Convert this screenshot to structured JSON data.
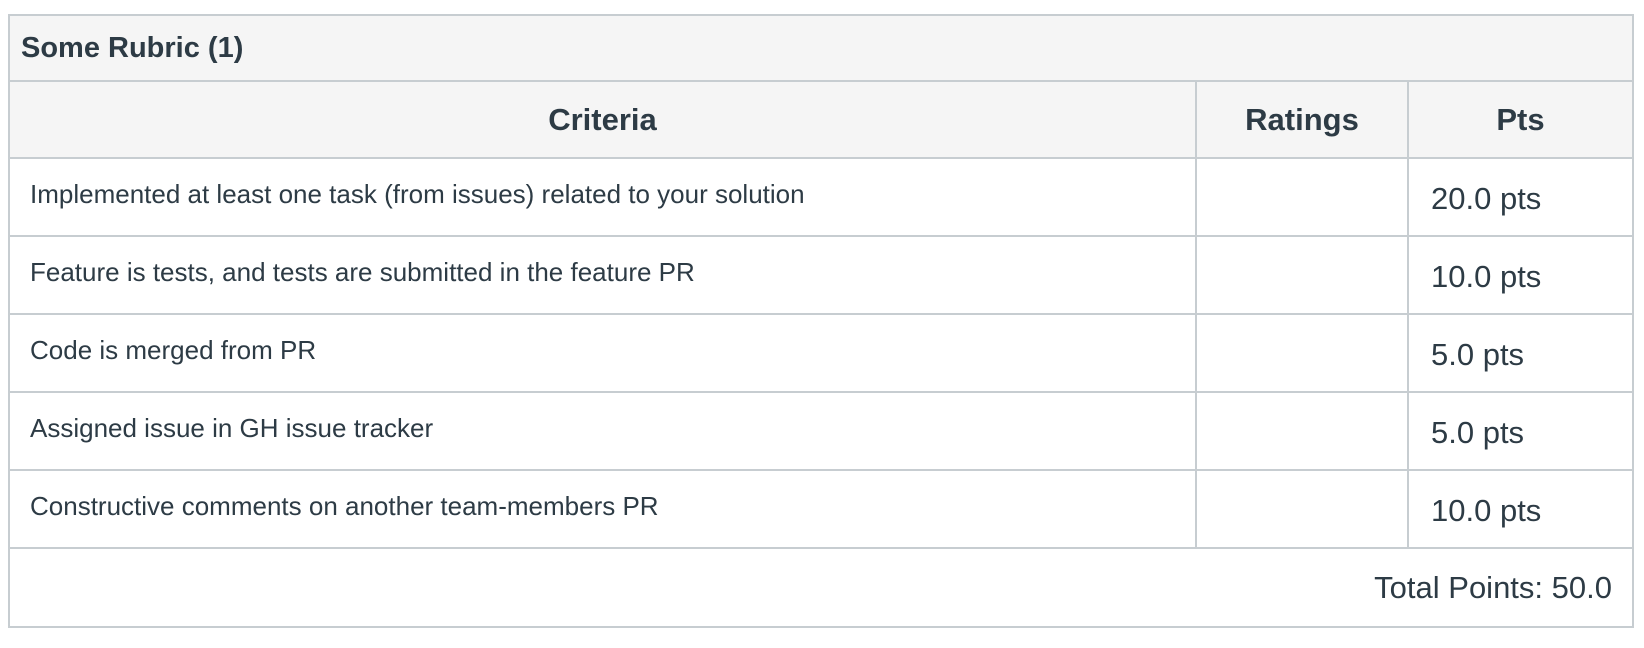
{
  "rubric": {
    "title": "Some Rubric (1)",
    "headers": {
      "criteria": "Criteria",
      "ratings": "Ratings",
      "pts": "Pts"
    },
    "rows": [
      {
        "criteria": "Implemented at least one task (from issues) related to your solution",
        "ratings": "",
        "pts": "20.0 pts"
      },
      {
        "criteria": "Feature is tests, and tests are submitted in the feature PR",
        "ratings": "",
        "pts": "10.0 pts"
      },
      {
        "criteria": "Code is merged from PR",
        "ratings": "",
        "pts": "5.0 pts"
      },
      {
        "criteria": "Assigned issue in GH issue tracker",
        "ratings": "",
        "pts": "5.0 pts"
      },
      {
        "criteria": "Constructive comments on another team-members PR",
        "ratings": "",
        "pts": "10.0 pts"
      }
    ],
    "total": "Total Points: 50.0"
  }
}
